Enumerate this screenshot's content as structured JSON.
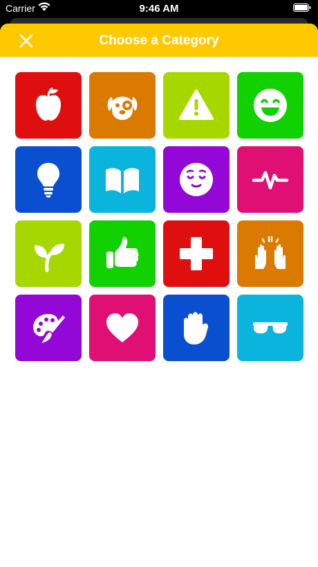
{
  "status_bar": {
    "carrier": "Carrier",
    "time": "9:46 AM"
  },
  "header": {
    "title": "Choose a Category",
    "close_icon": "close-icon",
    "color": "#ffc900"
  },
  "categories": [
    {
      "icon": "apple-icon",
      "color": "#e00f0f"
    },
    {
      "icon": "dog-face-icon",
      "color": "#da7a00"
    },
    {
      "icon": "warning-icon",
      "color": "#a6d800"
    },
    {
      "icon": "smiley-face-icon",
      "color": "#11d100"
    },
    {
      "icon": "lightbulb-icon",
      "color": "#0a4fcf"
    },
    {
      "icon": "open-book-icon",
      "color": "#0ab4dc"
    },
    {
      "icon": "relieved-face-icon",
      "color": "#9307d7"
    },
    {
      "icon": "heartbeat-icon",
      "color": "#e00f74"
    },
    {
      "icon": "sprout-icon",
      "color": "#a6d800"
    },
    {
      "icon": "thumbs-up-icon",
      "color": "#11d100"
    },
    {
      "icon": "medical-cross-icon",
      "color": "#e00f0f"
    },
    {
      "icon": "raised-hands-icon",
      "color": "#da7a00"
    },
    {
      "icon": "paint-palette-icon",
      "color": "#9307d7"
    },
    {
      "icon": "heart-icon",
      "color": "#e00f74"
    },
    {
      "icon": "raised-fist-icon",
      "color": "#0a4fcf"
    },
    {
      "icon": "sunglasses-icon",
      "color": "#0ab4dc"
    }
  ]
}
